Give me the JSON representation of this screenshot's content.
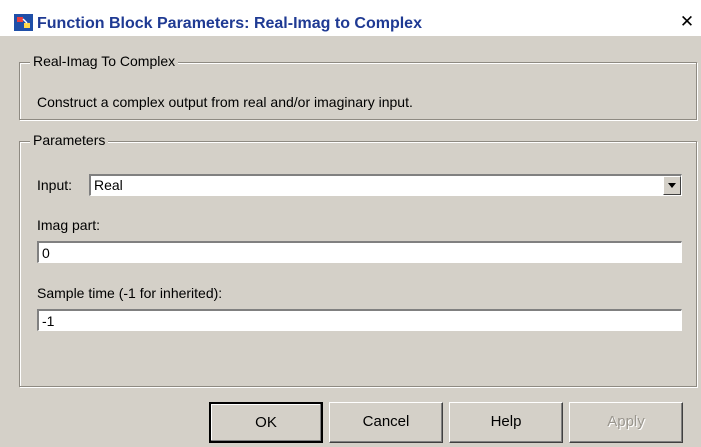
{
  "window": {
    "title": "Function Block Parameters: Real-Imag to Complex",
    "close_label": "✕"
  },
  "description_group": {
    "legend": "Real-Imag To Complex",
    "text": "Construct a complex output from real and/or imaginary input."
  },
  "parameters_group": {
    "legend": "Parameters",
    "input": {
      "label": "Input:",
      "value": "Real"
    },
    "imag_part": {
      "label": "Imag part:",
      "value": "0"
    },
    "sample_time": {
      "label": "Sample time (-1 for inherited):",
      "value": "-1"
    }
  },
  "buttons": {
    "ok": "OK",
    "cancel": "Cancel",
    "help": "Help",
    "apply": "Apply"
  }
}
